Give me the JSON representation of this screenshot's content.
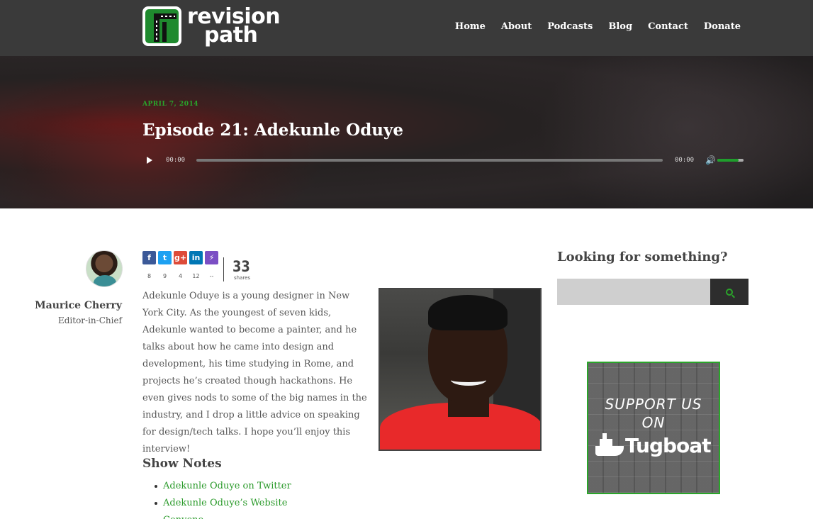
{
  "header": {
    "logo_line1": "revision",
    "logo_line2": "path",
    "nav": [
      "Home",
      "About",
      "Podcasts",
      "Blog",
      "Contact",
      "Donate"
    ]
  },
  "hero": {
    "date": "APRIL 7, 2014",
    "title": "Episode 21: Adekunle Oduye",
    "player": {
      "current_time": "00:00",
      "duration": "00:00",
      "progress": 0,
      "volume": 0.8
    }
  },
  "author": {
    "name": "Maurice Cherry",
    "role": "Editor-in-Chief"
  },
  "share": {
    "buttons": [
      {
        "icon": "facebook-icon",
        "glyph": "f",
        "count": "8",
        "color": "#3b5998"
      },
      {
        "icon": "twitter-icon",
        "glyph": "t",
        "count": "9",
        "color": "#1da1f2"
      },
      {
        "icon": "googleplus-icon",
        "glyph": "g+",
        "count": "4",
        "color": "#dd4b39"
      },
      {
        "icon": "linkedin-icon",
        "glyph": "in",
        "count": "12",
        "color": "#0077b5"
      },
      {
        "icon": "more-icon",
        "glyph": "⚡",
        "count": "--",
        "color": "#7b4fc4"
      }
    ],
    "total": "33",
    "total_label": "shares"
  },
  "article": {
    "intro": "Adekunle Oduye is a young designer in New York City. As the youngest of seven kids, Adekunle wanted to become a painter, and he talks about how he came into design and development, his time studying in Rome, and projects he’s created though hackathons. He even gives nods to some of the big names in the industry, and I drop a little advice on speaking for design/tech talks. I hope you’ll enjoy this interview!",
    "shownotes_title": "Show Notes",
    "shownotes": [
      "Adekunle Oduye on Twitter",
      "Adekunle Oduye’s Website",
      "Convene"
    ]
  },
  "sidebar": {
    "search_title": "Looking for something?",
    "search_placeholder": "",
    "support_line1": "SUPPORT US",
    "support_line2": "ON",
    "support_brand": "Tugboat"
  },
  "colors": {
    "accent": "#2aa52a",
    "header_bg": "#3a3a3a"
  }
}
